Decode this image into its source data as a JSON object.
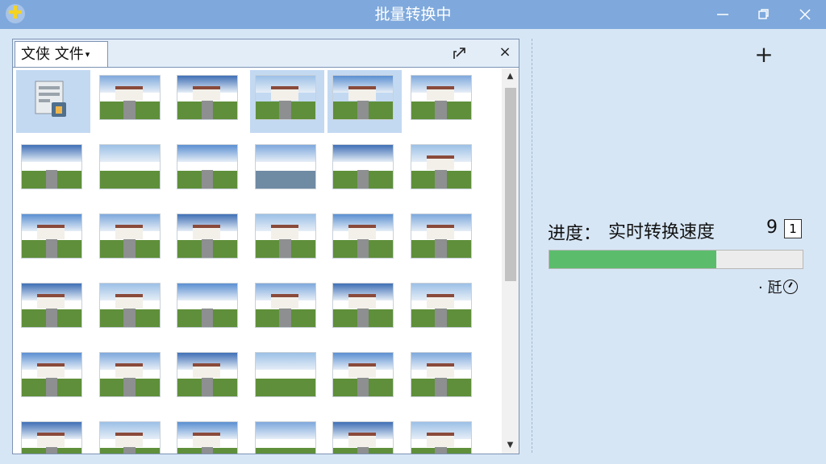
{
  "window": {
    "title": "批量转换中"
  },
  "colors": {
    "titlebar": "#7fa9dc",
    "progress_fill": "#5bbd6c",
    "selection": "#c3d9f2"
  },
  "pane": {
    "tab_label": "文侠  文件",
    "tab_caret": "▾",
    "close_label": "×"
  },
  "thumbnails": [
    {
      "kind": "folder",
      "selected": true
    },
    {
      "kind": "house",
      "selected": false
    },
    {
      "kind": "house",
      "selected": false
    },
    {
      "kind": "house",
      "selected": true
    },
    {
      "kind": "house",
      "selected": true
    },
    {
      "kind": "house",
      "selected": false
    },
    {
      "kind": "road",
      "selected": false
    },
    {
      "kind": "field",
      "selected": false
    },
    {
      "kind": "road",
      "selected": false
    },
    {
      "kind": "lake",
      "selected": false
    },
    {
      "kind": "road",
      "selected": false
    },
    {
      "kind": "house",
      "selected": false
    },
    {
      "kind": "house",
      "selected": false
    },
    {
      "kind": "house",
      "selected": false
    },
    {
      "kind": "house",
      "selected": false
    },
    {
      "kind": "house",
      "selected": false
    },
    {
      "kind": "house",
      "selected": false
    },
    {
      "kind": "house",
      "selected": false
    },
    {
      "kind": "house",
      "selected": false
    },
    {
      "kind": "house",
      "selected": false
    },
    {
      "kind": "road",
      "selected": false
    },
    {
      "kind": "house",
      "selected": false
    },
    {
      "kind": "house",
      "selected": false
    },
    {
      "kind": "house",
      "selected": false
    },
    {
      "kind": "house",
      "selected": false
    },
    {
      "kind": "house",
      "selected": false
    },
    {
      "kind": "house",
      "selected": false
    },
    {
      "kind": "field",
      "selected": false
    },
    {
      "kind": "house",
      "selected": false
    },
    {
      "kind": "house",
      "selected": false
    },
    {
      "kind": "house",
      "selected": false
    },
    {
      "kind": "house",
      "selected": false
    },
    {
      "kind": "house",
      "selected": false
    },
    {
      "kind": "field",
      "selected": false
    },
    {
      "kind": "house",
      "selected": false
    },
    {
      "kind": "house",
      "selected": false
    }
  ],
  "right_panel": {
    "add_label": "+",
    "progress_label": "进度：",
    "speed_label": "实时转换速度",
    "count_value": "9",
    "count_button": "1",
    "progress_fraction": 0.66,
    "status_text": "· 瓩"
  },
  "scrollbar": {
    "up": "▲",
    "down": "▼"
  }
}
